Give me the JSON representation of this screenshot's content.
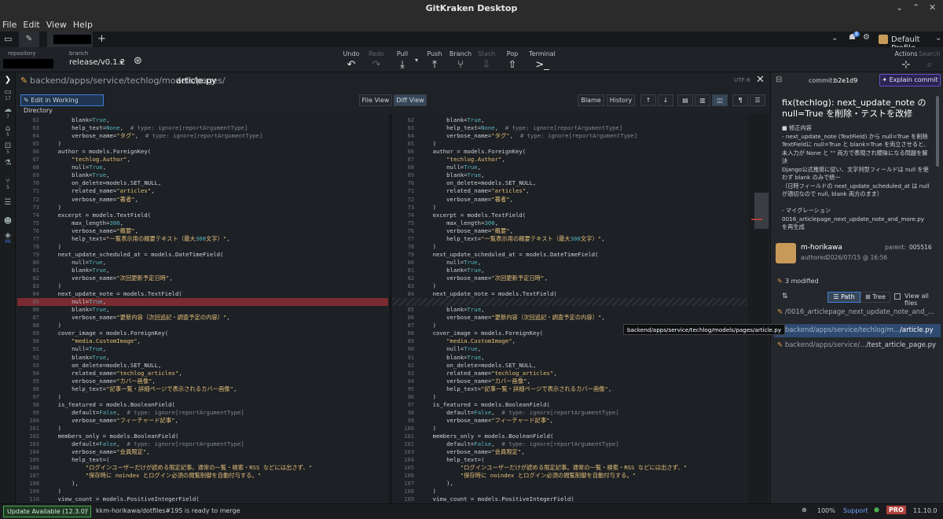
{
  "window": {
    "title": "GitKraken Desktop"
  },
  "menu": [
    "File",
    "Edit",
    "View",
    "Help"
  ],
  "tabs": {
    "new_tab": "+"
  },
  "profile": {
    "label": "Default Profile",
    "notif_count": "8"
  },
  "repo": {
    "label": "repository",
    "branch_label": "branch",
    "branch_value": "release/v0.1.2"
  },
  "toolbar": {
    "undo": "Undo",
    "redo": "Redo",
    "pull": "Pull",
    "push": "Push",
    "branch": "Branch",
    "stash": "Stash",
    "pop": "Pop",
    "terminal": "Terminal",
    "actions": "Actions",
    "search": "Search"
  },
  "rail": [
    "17",
    "7",
    "5",
    "5",
    "5",
    "96"
  ],
  "file": {
    "path": "backend/apps/service/techlog/models/pages/",
    "name": "article.py",
    "encoding": "UTF-8"
  },
  "diffbar": {
    "edit": "Edit in Working Directory",
    "file_view": "File View",
    "diff_view": "Diff View",
    "blame": "Blame",
    "history": "History"
  },
  "left_lines": [
    {
      "n": "62",
      "t": "        blank=True,"
    },
    {
      "n": "63",
      "t": "        help_text=None,  # type: ignore[reportArgumentType]"
    },
    {
      "n": "64",
      "t": "        verbose_name=\"タグ\",  # type: ignore[reportArgumentType]"
    },
    {
      "n": "65",
      "t": "    )"
    },
    {
      "n": "66",
      "t": "    author = models.ForeignKey("
    },
    {
      "n": "67",
      "t": "        \"techlog.Author\","
    },
    {
      "n": "68",
      "t": "        null=True,"
    },
    {
      "n": "69",
      "t": "        blank=True,"
    },
    {
      "n": "70",
      "t": "        on_delete=models.SET_NULL,"
    },
    {
      "n": "71",
      "t": "        related_name=\"articles\","
    },
    {
      "n": "72",
      "t": "        verbose_name=\"著者\","
    },
    {
      "n": "73",
      "t": "    )"
    },
    {
      "n": "74",
      "t": "    excerpt = models.TextField("
    },
    {
      "n": "75",
      "t": "        max_length=300,"
    },
    {
      "n": "76",
      "t": "        verbose_name=\"概要\","
    },
    {
      "n": "77",
      "t": "        help_text=\"一覧表示用の概要テキスト（最大300文字）\","
    },
    {
      "n": "78",
      "t": "    )"
    },
    {
      "n": "79",
      "t": "    next_update_scheduled_at = models.DateTimeField("
    },
    {
      "n": "80",
      "t": "        null=True,"
    },
    {
      "n": "81",
      "t": "        blank=True,"
    },
    {
      "n": "82",
      "t": "        verbose_name=\"次回更新予定日時\","
    },
    {
      "n": "83",
      "t": "    )"
    },
    {
      "n": "84",
      "t": "    next_update_note = models.TextField("
    },
    {
      "n": "85",
      "t": "        null=True,",
      "del": true
    },
    {
      "n": "86",
      "t": "        blank=True,"
    },
    {
      "n": "87",
      "t": "        verbose_name=\"更新内容（次回追記・調査予定の内容）\","
    },
    {
      "n": "88",
      "t": "    )"
    },
    {
      "n": "89",
      "t": "    cover_image = models.ForeignKey("
    },
    {
      "n": "90",
      "t": "        \"media.CustomImage\","
    },
    {
      "n": "91",
      "t": "        null=True,"
    },
    {
      "n": "92",
      "t": "        blank=True,"
    },
    {
      "n": "93",
      "t": "        on_delete=models.SET_NULL,"
    },
    {
      "n": "94",
      "t": "        related_name=\"techlog_articles\","
    },
    {
      "n": "95",
      "t": "        verbose_name=\"カバー画像\","
    },
    {
      "n": "96",
      "t": "        help_text=\"記事一覧・詳細ページで表示されるカバー画像\","
    },
    {
      "n": "97",
      "t": "    )"
    },
    {
      "n": "98",
      "t": "    is_featured = models.BooleanField("
    },
    {
      "n": "99",
      "t": "        default=False,  # type: ignore[reportArgumentType]"
    },
    {
      "n": "100",
      "t": "        verbose_name=\"フィーチャード記事\","
    },
    {
      "n": "101",
      "t": "    )"
    },
    {
      "n": "102",
      "t": "    members_only = models.BooleanField("
    },
    {
      "n": "103",
      "t": "        default=False,  # type: ignore[reportArgumentType]"
    },
    {
      "n": "104",
      "t": "        verbose_name=\"会員限定\","
    },
    {
      "n": "105",
      "t": "        help_text=("
    },
    {
      "n": "106",
      "t": "            \"ログインユーザーだけが読める限定記事。通常の一覧・検索・RSS などには出さず、\""
    },
    {
      "n": "107",
      "t": "            \"保存時に noindex とログイン必須の閲覧制御を自動付与する。\""
    },
    {
      "n": "108",
      "t": "        ),"
    },
    {
      "n": "109",
      "t": "    )"
    },
    {
      "n": "110",
      "t": "    view_count = models.PositiveIntegerField("
    }
  ],
  "right_lines": [
    {
      "n": "62",
      "t": "        blank=True,"
    },
    {
      "n": "63",
      "t": "        help_text=None,  # type: ignore[reportArgumentType]"
    },
    {
      "n": "64",
      "t": "        verbose_name=\"タグ\",  # type: ignore[reportArgumentType]"
    },
    {
      "n": "65",
      "t": "    )"
    },
    {
      "n": "66",
      "t": "    author = models.ForeignKey("
    },
    {
      "n": "67",
      "t": "        \"techlog.Author\","
    },
    {
      "n": "68",
      "t": "        null=True,"
    },
    {
      "n": "69",
      "t": "        blank=True,"
    },
    {
      "n": "70",
      "t": "        on_delete=models.SET_NULL,"
    },
    {
      "n": "71",
      "t": "        related_name=\"articles\","
    },
    {
      "n": "72",
      "t": "        verbose_name=\"著者\","
    },
    {
      "n": "73",
      "t": "    )"
    },
    {
      "n": "74",
      "t": "    excerpt = models.TextField("
    },
    {
      "n": "75",
      "t": "        max_length=300,"
    },
    {
      "n": "76",
      "t": "        verbose_name=\"概要\","
    },
    {
      "n": "77",
      "t": "        help_text=\"一覧表示用の概要テキスト（最大300文字）\","
    },
    {
      "n": "78",
      "t": "    )"
    },
    {
      "n": "79",
      "t": "    next_update_scheduled_at = models.DateTimeField("
    },
    {
      "n": "80",
      "t": "        null=True,"
    },
    {
      "n": "81",
      "t": "        blank=True,"
    },
    {
      "n": "82",
      "t": "        verbose_name=\"次回更新予定日時\","
    },
    {
      "n": "83",
      "t": "    )"
    },
    {
      "n": "84",
      "t": "    next_update_note = models.TextField("
    },
    {
      "n": "",
      "t": "",
      "hatch": true
    },
    {
      "n": "85",
      "t": "        blank=True,"
    },
    {
      "n": "86",
      "t": "        verbose_name=\"更新内容（次回追記・調査予定の内容）\","
    },
    {
      "n": "87",
      "t": "    )"
    },
    {
      "n": "88",
      "t": "    cover_image = models.ForeignKey("
    },
    {
      "n": "89",
      "t": "        \"media.CustomImage\","
    },
    {
      "n": "90",
      "t": "        null=True,"
    },
    {
      "n": "91",
      "t": "        blank=True,"
    },
    {
      "n": "92",
      "t": "        on_delete=models.SET_NULL,"
    },
    {
      "n": "93",
      "t": "        related_name=\"techlog_articles\","
    },
    {
      "n": "94",
      "t": "        verbose_name=\"カバー画像\","
    },
    {
      "n": "95",
      "t": "        help_text=\"記事一覧・詳細ページで表示されるカバー画像\","
    },
    {
      "n": "96",
      "t": "    )"
    },
    {
      "n": "97",
      "t": "    is_featured = models.BooleanField("
    },
    {
      "n": "98",
      "t": "        default=False,  # type: ignore[reportArgumentType]"
    },
    {
      "n": "99",
      "t": "        verbose_name=\"フィーチャード記事\","
    },
    {
      "n": "100",
      "t": "    )"
    },
    {
      "n": "101",
      "t": "    members_only = models.BooleanField("
    },
    {
      "n": "102",
      "t": "        default=False,  # type: ignore[reportArgumentType]"
    },
    {
      "n": "103",
      "t": "        verbose_name=\"会員限定\","
    },
    {
      "n": "104",
      "t": "        help_text=("
    },
    {
      "n": "105",
      "t": "            \"ログインユーザーだけが読める限定記事。通常の一覧・検索・RSS などには出さず、\""
    },
    {
      "n": "106",
      "t": "            \"保存時に noindex とログイン必須の閲覧制御を自動付与する。\""
    },
    {
      "n": "107",
      "t": "        ),"
    },
    {
      "n": "108",
      "t": "    )"
    },
    {
      "n": "109",
      "t": "    view_count = models.PositiveIntegerField("
    }
  ],
  "commit": {
    "id_label": "commit:",
    "id": "b2e1d9",
    "explain": "Explain commit",
    "title": "fix(techlog): next_update_note の null=True を削除・テストを改修",
    "body": [
      "■ 修正内容",
      "- next_update_note (TextField) から null=True を削除",
      "  TextFieldに null=True と blank=True を両立させると、未入力が None と \"\" 両方で表現され曖昧になる問題を解決",
      "  Django公式推奨に従い、文字列型フィールドは null を使わず blank のみで統一",
      "  （日時フィールドの next_update_scheduled_at は null が適切なので null, blank 両方のまま）",
      "",
      "- マイグレーション",
      "0016_articlepage_next_update_note_and_more.py を再生成"
    ],
    "author": "m-horikawa",
    "authored_label": "authored",
    "date": "2026/07/15 @ 16:56",
    "parent_label": "parent:",
    "parent": "005516",
    "modified": "3 modified",
    "path_btn": "Path",
    "tree_btn": "Tree",
    "view_all": "View all files",
    "files": [
      {
        "dir": "/0016_articlepage_next_update_note_and_...",
        "name": ""
      },
      {
        "dir": "backend/apps/service/techlog/m...",
        "name": "/article.py"
      },
      {
        "dir": "backend/apps/service/...",
        "name": "/test_article_page.py"
      }
    ],
    "tooltip": "backend/apps/service/techlog/models/pages/article.py"
  },
  "status": {
    "update": "Update Available (12.3.0)",
    "merge": "kkm-horikawa/dotfiles#195 is ready to merge",
    "zoom": "100%",
    "support": "Support",
    "pro": "PRO",
    "version": "11.10.0"
  }
}
